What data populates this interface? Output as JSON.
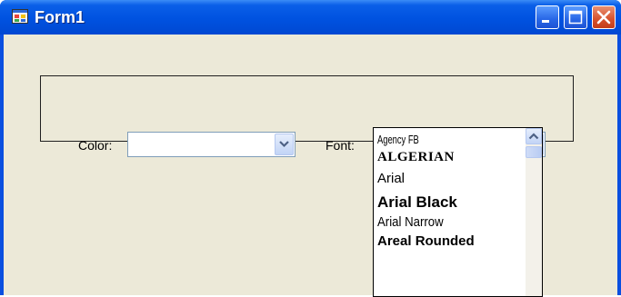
{
  "window": {
    "title": "Form1"
  },
  "form": {
    "color_label": "Color:",
    "color_value": "",
    "font_label": "Font:",
    "font_value": ""
  },
  "font_list": {
    "items": [
      "Agency FB",
      "ALGERIAN",
      "Arial",
      "Arial Black",
      "Arial Narrow",
      "Areal Rounded"
    ]
  },
  "icons": {
    "app": "form-icon",
    "minimize": "minimize-icon",
    "maximize": "maximize-icon",
    "close": "close-icon",
    "dropdown": "chevron-down-icon",
    "scroll_up": "chevron-up-icon"
  },
  "colors": {
    "title_bar": "#0052e0",
    "client_background": "#ece9d8",
    "close_button": "#d6512c"
  }
}
